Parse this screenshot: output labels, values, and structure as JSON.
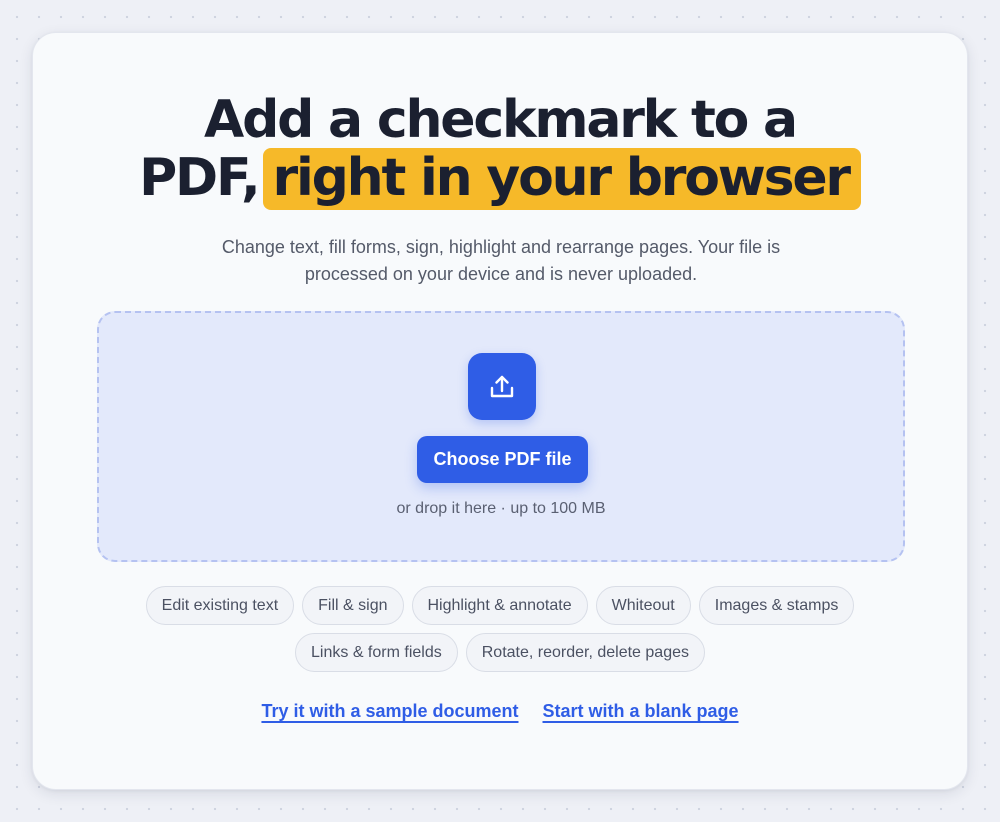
{
  "hero": {
    "title_line1": "Add a checkmark to a",
    "title_line2_plain": "PDF,",
    "title_line2_highlight": "right in your browser",
    "subtitle": "Change text, fill forms, sign, highlight and rearrange pages. Your file is processed on your device and is never uploaded."
  },
  "upload": {
    "icon": "upload-icon",
    "choose_label": "Choose PDF file",
    "hint": "or drop it here · up to 100 MB"
  },
  "features": {
    "row1": [
      "Edit existing text",
      "Fill & sign",
      "Highlight & annotate",
      "Whiteout",
      "Images & stamps"
    ],
    "row2": [
      "Links & form fields",
      "Rotate, reorder, delete pages"
    ]
  },
  "links": {
    "sample": "Try it with a sample document",
    "blank": "Start with a blank page"
  },
  "colors": {
    "accent": "#2f5de6",
    "highlight": "#f6b929",
    "dropzone_bg": "#e3e9fb"
  }
}
